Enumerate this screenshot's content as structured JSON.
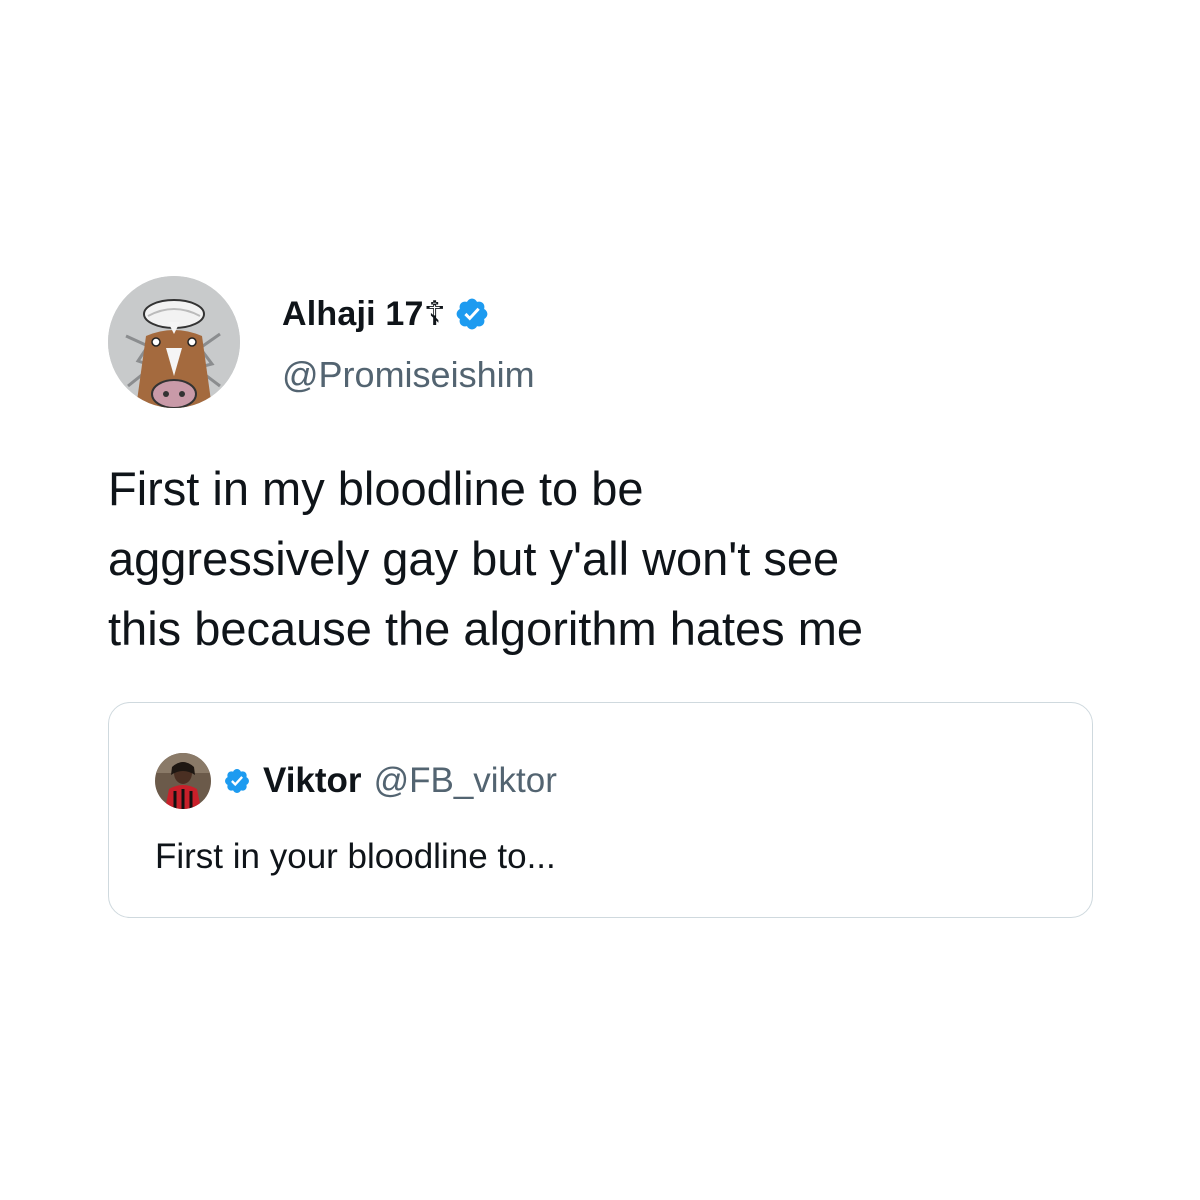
{
  "tweet": {
    "author": {
      "display_name": "Alhaji 17☦",
      "handle": "@Promiseishim",
      "verified": true,
      "avatar_icon": "horse-cartoon-avatar"
    },
    "text": "First in my bloodline to be\naggressively gay but y'all won't see\nthis because the algorithm hates me",
    "quoted_tweet": {
      "display_name": "Viktor",
      "handle": "@FB_viktor",
      "verified": true,
      "avatar_icon": "person-photo-avatar",
      "text": "First in your bloodline to..."
    }
  },
  "colors": {
    "verified_blue": "#1d9bf0",
    "handle_gray": "#536471",
    "border_gray": "#cfd9de",
    "text_black": "#0f1419"
  }
}
